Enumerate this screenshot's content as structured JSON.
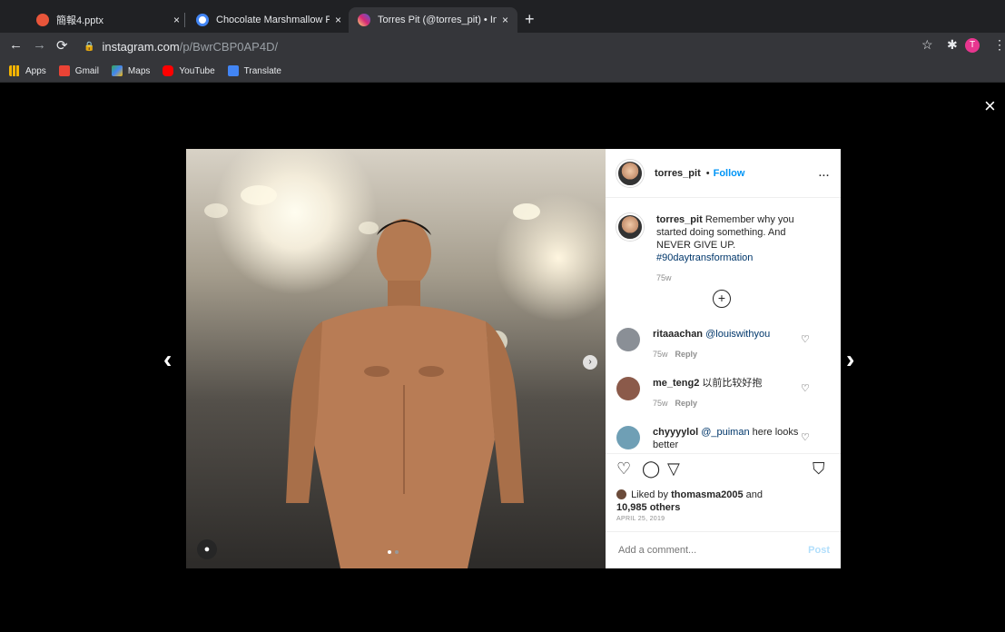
{
  "browser": {
    "tabs": [
      {
        "title": "簡報4.pptx",
        "favicon_color": "#e8553a"
      },
      {
        "title": "Chocolate Marshmallow Poutin",
        "favicon_color": "#ffffff"
      },
      {
        "title": "Torres Pit (@torres_pit) • Insta",
        "favicon_color": "#e1306c"
      }
    ],
    "new_tab": "+",
    "close_tab": "×",
    "url_domain": "instagram.com",
    "url_path": "/p/BwrCBP0AP4D/",
    "profile_initial": "T",
    "bookmarks": [
      {
        "label": "Apps",
        "color": "#f4b400"
      },
      {
        "label": "Gmail",
        "color": "#ea4335"
      },
      {
        "label": "Maps",
        "color": "#34a853"
      },
      {
        "label": "YouTube",
        "color": "#ff0000"
      },
      {
        "label": "Translate",
        "color": "#4285f4"
      }
    ]
  },
  "post": {
    "username": "torres_pit",
    "separator": "•",
    "follow_label": "Follow",
    "more": "...",
    "caption": {
      "username": "torres_pit",
      "text": "Remember why you started doing something. And NEVER GIVE UP.",
      "hashtag": "#90daytransformation",
      "age": "75w"
    },
    "load_more_icon": "+",
    "comments": [
      {
        "username": "ritaaachan",
        "mention": "@louiswithyou",
        "text": "",
        "age": "75w",
        "reply": "Reply",
        "avatar_color": "#8a8f96"
      },
      {
        "username": "me_teng2",
        "mention": "",
        "text": "以前比较好抱",
        "age": "75w",
        "reply": "Reply",
        "avatar_color": "#8b5a4a"
      },
      {
        "username": "chyyyylol",
        "mention": "@_puiman",
        "text": "here looks better",
        "age": "",
        "reply": "",
        "avatar_color": "#6f9fb5"
      }
    ],
    "likes": {
      "prefix": "Liked by",
      "user": "thomasma2005",
      "and": "and",
      "others": "10,985 others"
    },
    "date": "APRIL 25, 2019",
    "comment_placeholder": "Add a comment...",
    "post_label": "Post"
  },
  "modal": {
    "close": "×",
    "prev": "‹",
    "next": "›"
  }
}
